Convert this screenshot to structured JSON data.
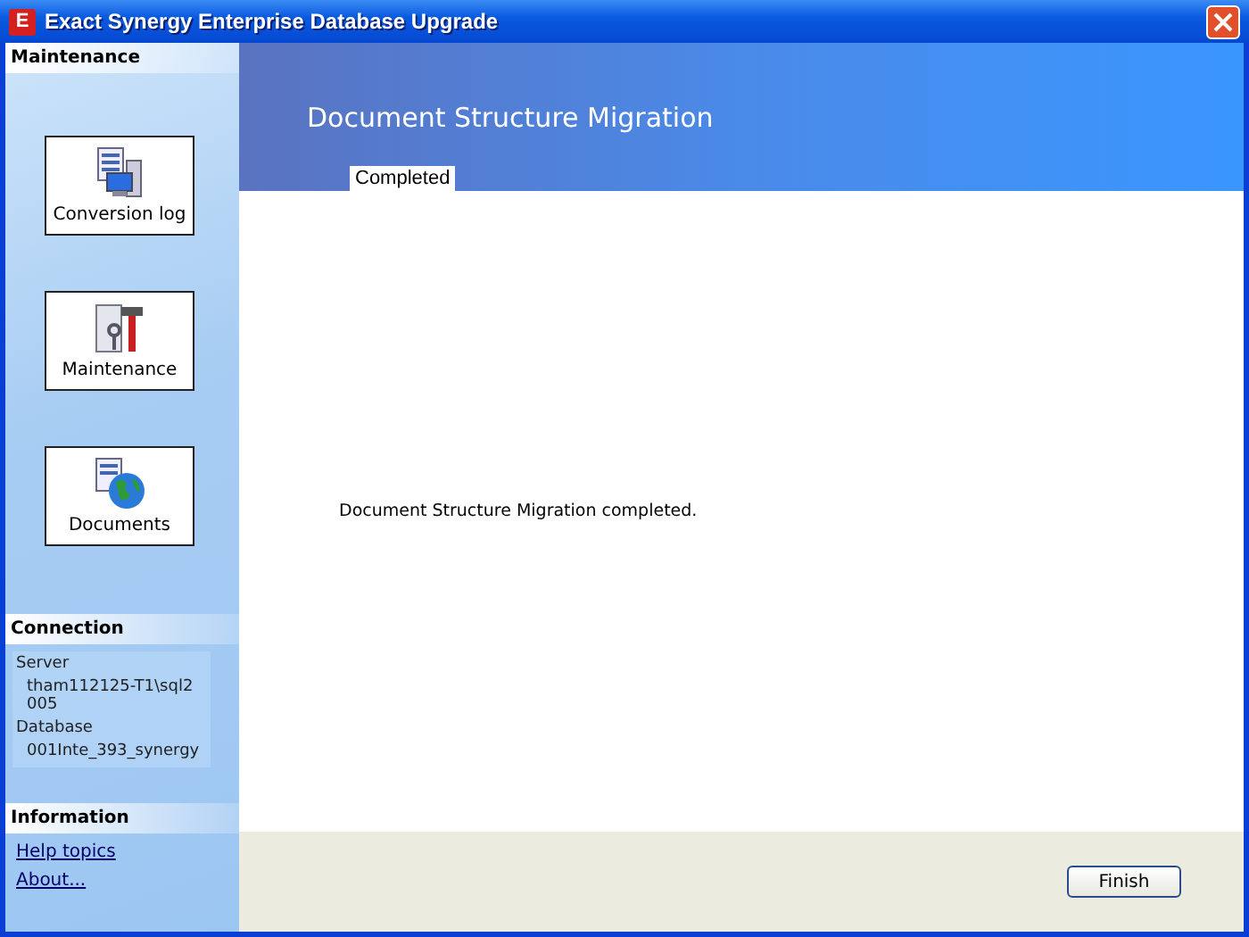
{
  "window": {
    "title": "Exact Synergy Enterprise Database Upgrade",
    "app_icon_letter": "E"
  },
  "sidebar": {
    "maintenance": {
      "heading": "Maintenance",
      "buttons": [
        {
          "label": "Conversion log",
          "kind": "log"
        },
        {
          "label": "Maintenance",
          "kind": "tools"
        },
        {
          "label": "Documents",
          "kind": "documents"
        }
      ]
    },
    "connection": {
      "heading": "Connection",
      "fields": [
        {
          "label": "Server",
          "value": "tham112125-T1\\sql2005"
        },
        {
          "label": "Database",
          "value": "001Inte_393_synergy"
        }
      ]
    },
    "information": {
      "heading": "Information",
      "links": [
        "Help topics",
        "About..."
      ]
    }
  },
  "header": {
    "title": "Document Structure Migration",
    "tabs": [
      {
        "label": "Completed",
        "selected": true
      }
    ]
  },
  "content": {
    "message": "Document Structure Migration completed."
  },
  "footer": {
    "buttons": [
      "Finish"
    ]
  }
}
